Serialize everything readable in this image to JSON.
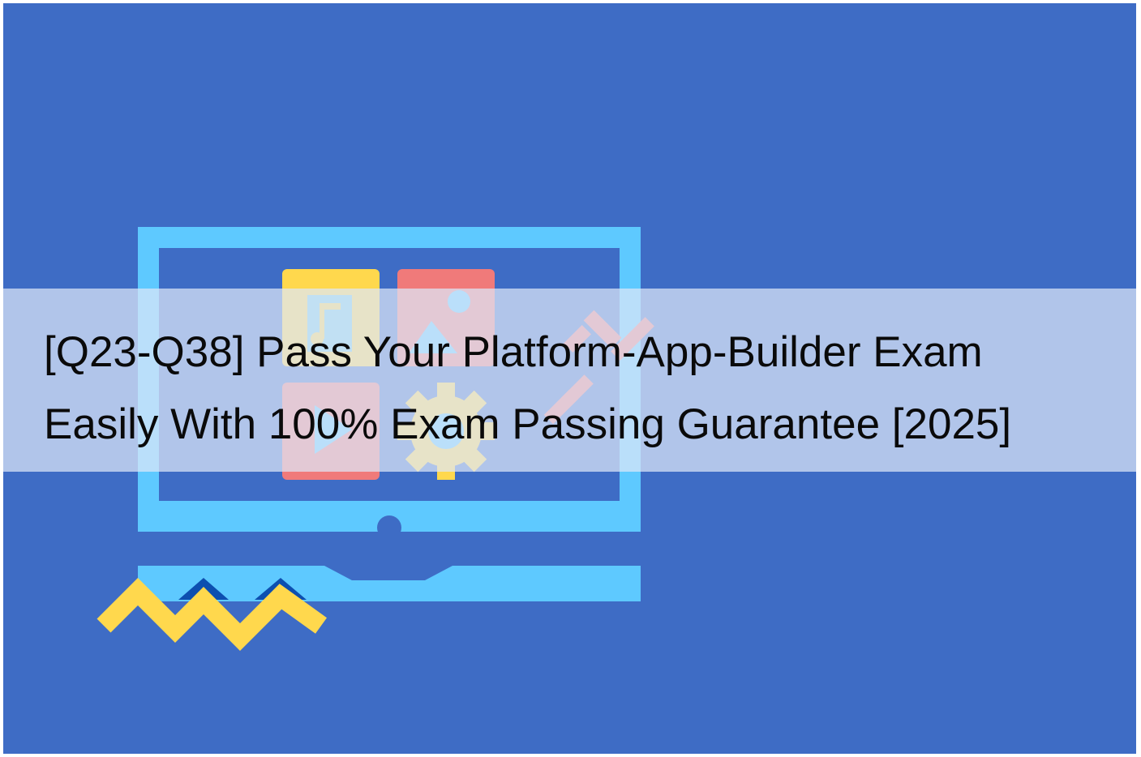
{
  "title": "[Q23-Q38] Pass Your Platform-App-Builder Exam\nEasily With 100% Exam Passing Guarantee [2025]",
  "colors": {
    "background": "#3e6cc5",
    "monitor": "#5ec9ff",
    "band": "#dee8f8",
    "tile_yellow": "#ffd84d",
    "tile_red": "#f07a7a",
    "zigzag_yellow": "#ffd84d",
    "zigzag_blue": "#0d4fb0",
    "text": "#0a0a0a"
  },
  "icons": [
    "music-file-icon",
    "image-file-icon",
    "video-file-icon",
    "gear-icon",
    "checkmark-icon"
  ]
}
